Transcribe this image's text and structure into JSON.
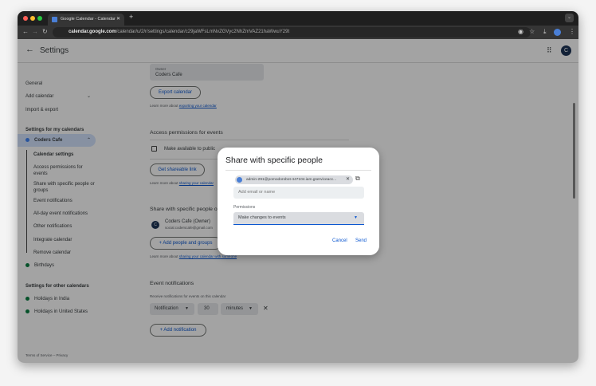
{
  "browser": {
    "tab_title": "Google Calendar - Calendar",
    "url_host": "calendar.google.com",
    "url_path": "/calendar/u/2/r/settings/calendar/c29jaWFsLmNvZGVyc2NhZmVAZ21haWwuY29t"
  },
  "header": {
    "title": "Settings",
    "avatar": "C"
  },
  "sidebar": {
    "items": [
      "General",
      "Add calendar",
      "Import & export"
    ],
    "my_calendars_heading": "Settings for my calendars",
    "selected_calendar": "Coders Cafe",
    "sub_items": [
      "Calendar settings",
      "Access permissions for events",
      "Share with specific people or groups",
      "Event notifications",
      "All-day event notifications",
      "Other notifications",
      "Integrate calendar",
      "Remove calendar"
    ],
    "birthdays": "Birthdays",
    "other_heading": "Settings for other calendars",
    "other_calendars": [
      "Holidays in India",
      "Holidays in United States"
    ],
    "footer": "Terms of Service – Privacy",
    "colors": {
      "coders": "#4285f4",
      "green": "#0b8043"
    }
  },
  "main": {
    "owner_label": "Owner",
    "owner_value": "Coders Cafe",
    "export_button": "Export calendar",
    "learn_export_prefix": "Learn more about ",
    "learn_export_link": "exporting your calendar",
    "access_heading": "Access permissions for events",
    "make_public": "Make available to public",
    "shareable_link": "Get shareable link",
    "learn_share_prefix": "Learn more about ",
    "learn_share_link": "sharing your calendar",
    "share_heading": "Share with specific people or groups",
    "owner_name": "Coders Cafe (Owner)",
    "owner_email": "social.coderscafe@gmail.com",
    "add_people": "Add people and groups",
    "learn_someone_link": "sharing your calendar with someone",
    "notif_heading": "Event notifications",
    "notif_desc": "Receive notifications for events on this calendar",
    "notif_type": "Notification",
    "notif_value": "30",
    "notif_unit": "minutes",
    "add_notification": "Add notification"
  },
  "dialog": {
    "title": "Share with specific people",
    "chip_email": "admin-291@pomodorobot-447104.iam.gserviceacc...",
    "input_placeholder": "Add email or name",
    "permissions_label": "Permissions",
    "permissions_value": "Make changes to events",
    "cancel": "Cancel",
    "send": "Send"
  }
}
